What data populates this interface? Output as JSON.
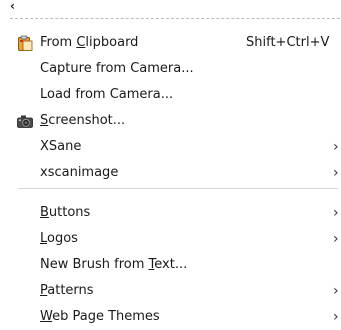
{
  "menu": {
    "tearoff_glyph": "‹",
    "items": [
      {
        "label_parts": [
          "From ",
          "C",
          "lipboard"
        ],
        "accel": "Shift+Ctrl+V",
        "icon": "clipboard-icon"
      },
      {
        "label_parts": [
          "Capture from Camera...",
          "",
          ""
        ]
      },
      {
        "label_parts": [
          "Load from Camera...",
          "",
          ""
        ]
      },
      {
        "label_parts": [
          "",
          "S",
          "creenshot..."
        ],
        "icon": "camera-icon"
      },
      {
        "label_parts": [
          "XSane",
          "",
          ""
        ],
        "submenu_glyph": "›"
      },
      {
        "label_parts": [
          "xscanimage",
          "",
          ""
        ],
        "submenu_glyph": "›"
      },
      {
        "label_parts": [
          "",
          "B",
          "uttons"
        ],
        "submenu_glyph": "›"
      },
      {
        "label_parts": [
          "",
          "L",
          "ogos"
        ],
        "submenu_glyph": "›"
      },
      {
        "label_parts": [
          "New Brush from ",
          "T",
          "ext..."
        ]
      },
      {
        "label_parts": [
          "",
          "P",
          "atterns"
        ],
        "submenu_glyph": "›"
      },
      {
        "label_parts": [
          "",
          "W",
          "eb Page Themes"
        ],
        "submenu_glyph": "›"
      }
    ]
  }
}
